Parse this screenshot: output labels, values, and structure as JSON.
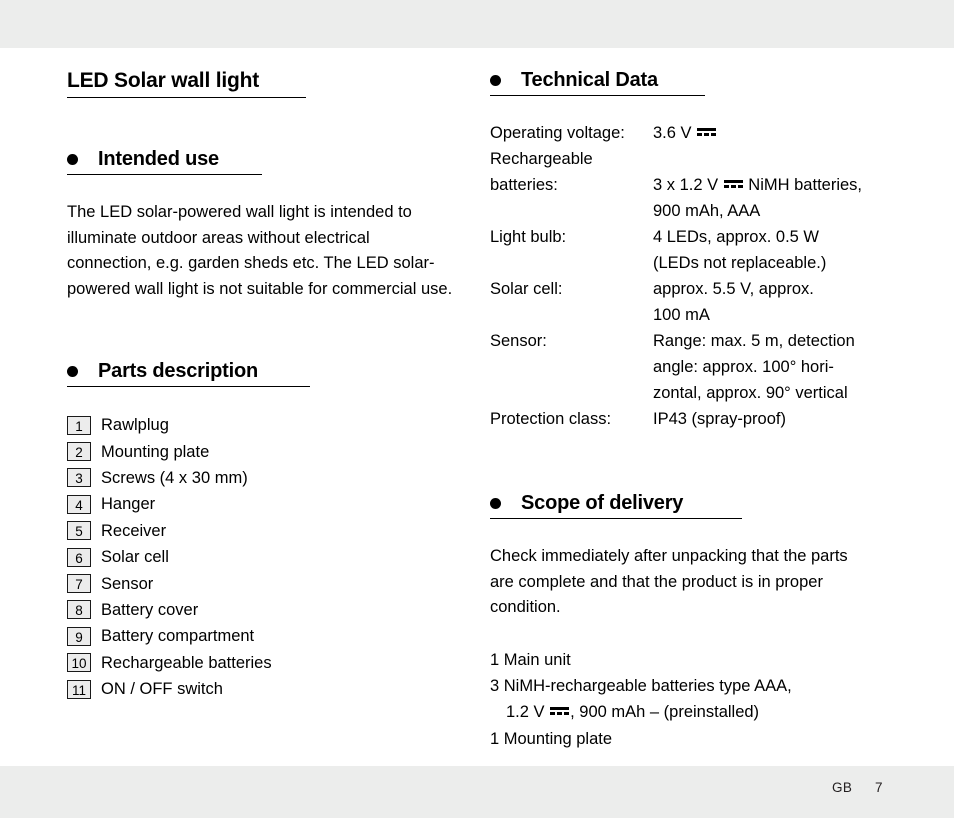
{
  "document": {
    "title": "LED Solar wall light"
  },
  "left_column": {
    "intended_use": {
      "heading": "Intended use",
      "body": "The LED solar-powered wall light is intended to illuminate outdoor areas without electrical connection, e.g. garden sheds etc. The LED solar-powered wall light is not suitable for commercial use."
    },
    "parts_description": {
      "heading": "Parts description",
      "items": [
        {
          "number": "1",
          "label": "Rawlplug"
        },
        {
          "number": "2",
          "label": "Mounting plate"
        },
        {
          "number": "3",
          "label": "Screws (4 x 30 mm)"
        },
        {
          "number": "4",
          "label": "Hanger"
        },
        {
          "number": "5",
          "label": "Receiver"
        },
        {
          "number": "6",
          "label": "Solar cell"
        },
        {
          "number": "7",
          "label": "Sensor"
        },
        {
          "number": "8",
          "label": "Battery cover"
        },
        {
          "number": "9",
          "label": "Battery compartment"
        },
        {
          "number": "10",
          "label": "Rechargeable batteries"
        },
        {
          "number": "11",
          "label": "ON / OFF switch"
        }
      ]
    }
  },
  "right_column": {
    "technical_data": {
      "heading": "Technical Data",
      "rows": [
        {
          "key": "Operating voltage:",
          "value_before_dc": "3.6 V ",
          "has_dc": true,
          "value_after_dc": ""
        },
        {
          "key": "Rechargeable batteries:",
          "key_line1": "Rechargeable",
          "key_line2": "batteries:",
          "value_before_dc": "3 x 1.2 V ",
          "has_dc": true,
          "value_after_dc": " NiMH batteries,",
          "value_line2": "900 mAh, AAA"
        },
        {
          "key": "Light bulb:",
          "value_line1": "4 LEDs, approx. 0.5 W",
          "value_line2": "(LEDs not replaceable.)"
        },
        {
          "key": "Solar cell:",
          "value_line1": "approx. 5.5 V, approx.",
          "value_line2": "100 mA"
        },
        {
          "key": "Sensor:",
          "value_line1": "Range: max. 5 m, detection",
          "value_line2": "angle: approx. 100° hori-",
          "value_line3": "zontal, approx. 90° vertical"
        },
        {
          "key": "Protection class:",
          "value_line1": "IP43 (spray-proof)"
        }
      ]
    },
    "scope_of_delivery": {
      "heading": "Scope of delivery",
      "body": "Check immediately after unpacking that the parts are complete and that the product is in proper condition.",
      "items_line1": "1 Main unit",
      "items_line2": "3 NiMH-rechargeable batteries type AAA,",
      "items_line3_before_dc": "1.2 V ",
      "items_line3_after_dc": ", 900 mAh  –  (preinstalled)",
      "items_line4": "1 Mounting plate"
    }
  },
  "footer": {
    "locale": "GB",
    "page_number": "7"
  },
  "colors": {
    "band": "#ecedec",
    "page": "#ffffff",
    "text": "#000000",
    "num_box_fill": "#ececec"
  }
}
